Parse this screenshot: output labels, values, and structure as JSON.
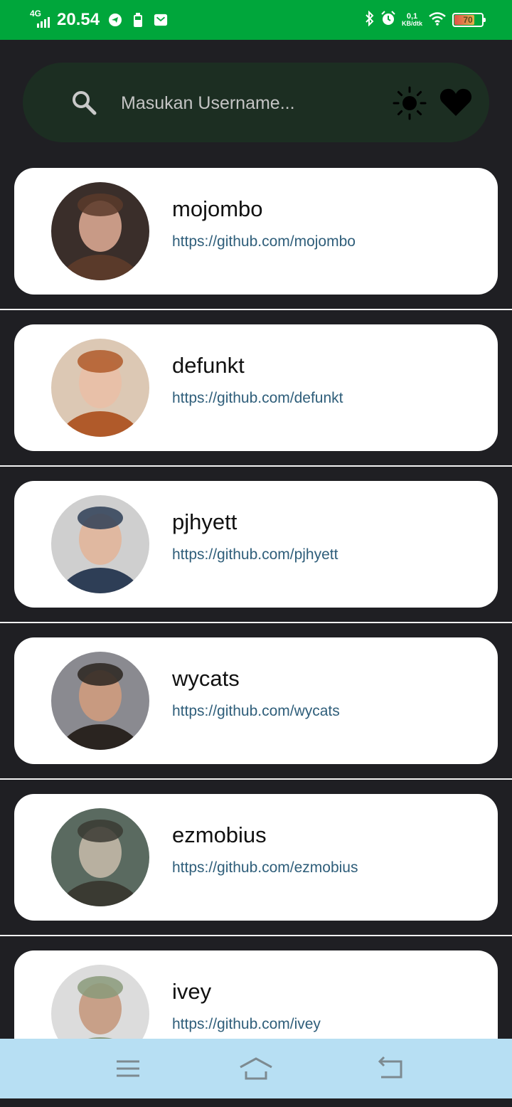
{
  "status_bar": {
    "network": "4G",
    "time": "20.54",
    "speed_value": "0,1",
    "speed_unit": "KB/dtk",
    "battery_level": "70",
    "icons": [
      "telegram-icon",
      "battery-saver-icon",
      "gmail-icon",
      "bluetooth-icon",
      "alarm-icon",
      "wifi-icon"
    ]
  },
  "search": {
    "placeholder": "Masukan Username...",
    "value": "",
    "icons": [
      "search-icon",
      "sun-icon",
      "heart-icon"
    ]
  },
  "users": [
    {
      "login": "mojombo",
      "url": "https://github.com/mojombo",
      "avatar_colors": [
        "#3a2e2a",
        "#c89a86",
        "#5a3a2a"
      ]
    },
    {
      "login": "defunkt",
      "url": "https://github.com/defunkt",
      "avatar_colors": [
        "#dcc8b4",
        "#e8c0a8",
        "#b05a2a"
      ]
    },
    {
      "login": "pjhyett",
      "url": "https://github.com/pjhyett",
      "avatar_colors": [
        "#cfcfcf",
        "#e0b8a0",
        "#2e3e56"
      ]
    },
    {
      "login": "wycats",
      "url": "https://github.com/wycats",
      "avatar_colors": [
        "#8a8a90",
        "#c89a80",
        "#2a2420"
      ]
    },
    {
      "login": "ezmobius",
      "url": "https://github.com/ezmobius",
      "avatar_colors": [
        "#5a6a60",
        "#b8b0a0",
        "#3a3a32"
      ]
    },
    {
      "login": "ivey",
      "url": "https://github.com/ivey",
      "avatar_colors": [
        "#dcdcdc",
        "#c8a088",
        "#8a9a7a"
      ]
    }
  ],
  "nav": {
    "icons": [
      "menu-icon",
      "home-icon",
      "back-icon"
    ]
  },
  "colors": {
    "status_bar": "#00a63b",
    "background": "#1f1f23",
    "search_bar": "#1c2e22",
    "card": "#ffffff",
    "url_text": "#2f5e7a",
    "nav_bar": "#b7dff3"
  }
}
